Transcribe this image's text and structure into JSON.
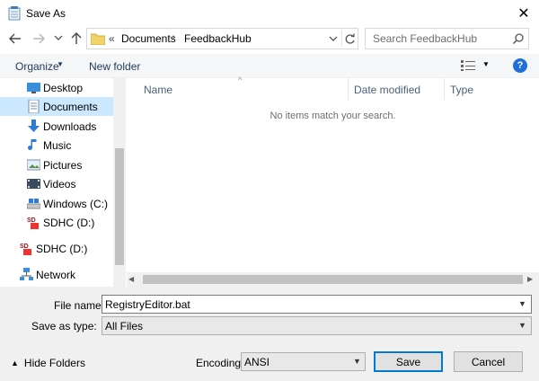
{
  "window": {
    "title": "Save As",
    "close_glyph": "✕"
  },
  "address": {
    "chevron": "«",
    "crumbs": [
      "Documents",
      "FeedbackHub"
    ],
    "separator": "›"
  },
  "search": {
    "placeholder": "Search FeedbackHub"
  },
  "toolbar": {
    "organize_label": "Organize",
    "new_folder_label": "New folder",
    "help_glyph": "?"
  },
  "nav": {
    "items": [
      {
        "label": "Desktop",
        "icon": "desktop-icon"
      },
      {
        "label": "Documents",
        "icon": "documents-icon",
        "selected": true
      },
      {
        "label": "Downloads",
        "icon": "downloads-icon"
      },
      {
        "label": "Music",
        "icon": "music-icon"
      },
      {
        "label": "Pictures",
        "icon": "pictures-icon"
      },
      {
        "label": "Videos",
        "icon": "videos-icon"
      },
      {
        "label": "Windows (C:)",
        "icon": "drive-icon"
      },
      {
        "label": "SDHC (D:)",
        "icon": "sd-card-icon"
      },
      {
        "label": "SDHC (D:)",
        "icon": "sd-card-icon"
      },
      {
        "label": "Network",
        "icon": "network-icon"
      }
    ]
  },
  "files": {
    "columns": [
      "Name",
      "Date modified",
      "Type"
    ],
    "empty_message": "No items match your search."
  },
  "form": {
    "file_name_label": "File name:",
    "file_name_value": "RegistryEditor.bat",
    "save_type_label": "Save as type:",
    "save_type_value": "All Files",
    "encoding_label": "Encoding:",
    "encoding_value": "ANSI"
  },
  "footer": {
    "hide_folders_label": "Hide Folders",
    "save_label": "Save",
    "cancel_label": "Cancel"
  },
  "colors": {
    "accent": "#0078d7",
    "selection": "#cce8ff",
    "link": "#1e395b"
  }
}
